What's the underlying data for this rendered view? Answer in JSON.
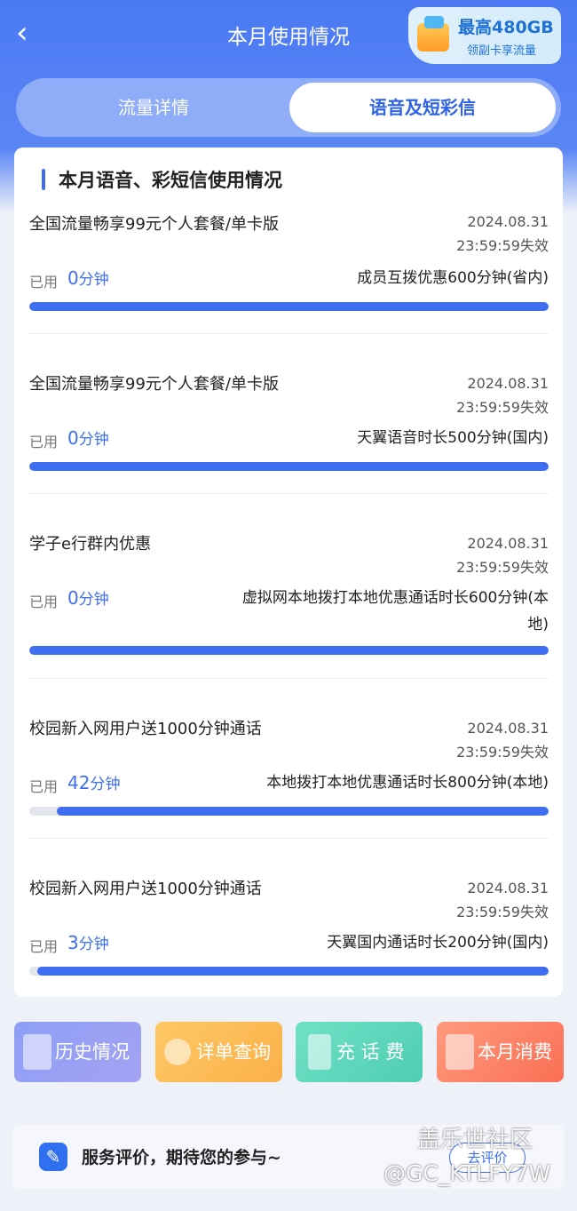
{
  "header": {
    "back_icon": "chevron-left-icon",
    "title": "本月使用情况"
  },
  "tabs": [
    {
      "label": "流量详情",
      "active": false
    },
    {
      "label": "语音及短彩信",
      "active": true
    }
  ],
  "section": {
    "title": "本月语音、彩短信使用情况"
  },
  "promo": {
    "title": "最高480GB",
    "subtitle": "领副卡享流量"
  },
  "items": [
    {
      "name": "全国流量畅享99元个人套餐/单卡版",
      "date": "2024.08.31",
      "expire": "23:59:59失效",
      "used_label": "已用",
      "used_value": "0",
      "used_unit": "分钟",
      "benefit": "成员互拨优惠600分钟(省内)",
      "remaining_fraction": 1.0
    },
    {
      "name": "全国流量畅享99元个人套餐/单卡版",
      "date": "2024.08.31",
      "expire": "23:59:59失效",
      "used_label": "已用",
      "used_value": "0",
      "used_unit": "分钟",
      "benefit": "天翼语音时长500分钟(国内)",
      "remaining_fraction": 1.0
    },
    {
      "name": "学子e行群内优惠",
      "date": "2024.08.31",
      "expire": "23:59:59失效",
      "used_label": "已用",
      "used_value": "0",
      "used_unit": "分钟",
      "benefit_line1": "虚拟网本地拨打本地优惠通话时长600分钟(本",
      "benefit_line2": "地)",
      "remaining_fraction": 1.0
    },
    {
      "name": "校园新入网用户送1000分钟通话",
      "date": "2024.08.31",
      "expire": "23:59:59失效",
      "used_label": "已用",
      "used_value": "42",
      "used_unit": "分钟",
      "benefit": "本地拨打本地优惠通话时长800分钟(本地)",
      "remaining_fraction": 0.9475
    },
    {
      "name": "校园新入网用户送1000分钟通话",
      "date": "2024.08.31",
      "expire": "23:59:59失效",
      "used_label": "已用",
      "used_value": "3",
      "used_unit": "分钟",
      "benefit": "天翼国内通话时长200分钟(国内)",
      "remaining_fraction": 0.985
    }
  ],
  "actions": [
    {
      "label": "历史情况",
      "icon": "scroll-icon"
    },
    {
      "label": "详单查询",
      "icon": "magnifier-icon"
    },
    {
      "label": "充 话 费",
      "icon": "phone-yuan-icon"
    },
    {
      "label": "本月消费",
      "icon": "bill-icon"
    }
  ],
  "review": {
    "icon": "edit-icon",
    "text": "服务评价，期待您的参与~",
    "button": "去评价"
  },
  "watermark": {
    "line1": "盖乐世社区",
    "line2": "@GC_KTLFY7W"
  },
  "colors": {
    "primary": "#3f6ef0",
    "header_bg": "#4a79f3"
  }
}
